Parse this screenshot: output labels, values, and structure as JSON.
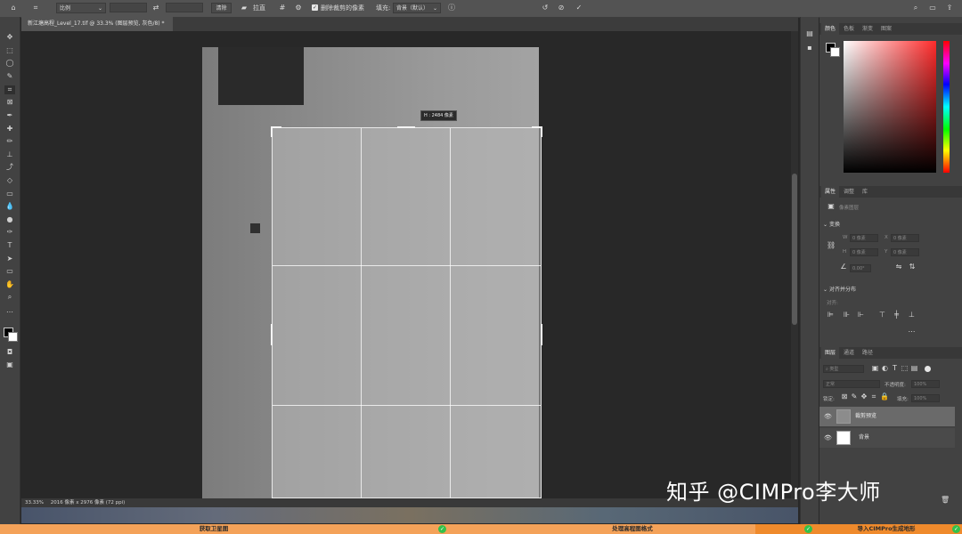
{
  "options_bar": {
    "ratio_select": "比例",
    "clear_button": "清除",
    "straighten_label": "拉直",
    "delete_cropped_label": "删除裁剪的像素",
    "fill_label": "填充:",
    "fill_select": "背景（默认）"
  },
  "document": {
    "tab_title": "新江塘高程_Level_17.tif @ 33.3% (图层预览, 灰色/8) *"
  },
  "canvas": {
    "tooltip": "H : 2484 像素"
  },
  "status_bar": {
    "zoom": "33.33%",
    "doc_info": "2016 像素 x 2976 像素 (72 ppi)"
  },
  "color_panel": {
    "tabs": [
      "颜色",
      "色板",
      "渐变",
      "图案"
    ],
    "active_tab": 0
  },
  "properties_panel": {
    "tabs": [
      "属性",
      "调整",
      "库"
    ],
    "active_tab": 0,
    "pixel_layer_label": "像素图层",
    "transform_label": "变换",
    "w_label": "W",
    "w_value": "0 像素",
    "x_label": "X",
    "x_value": "0 像素",
    "h_label": "H",
    "h_value": "0 像素",
    "y_label": "Y",
    "y_value": "0 像素",
    "angle_value": "0.00°",
    "align_label": "对齐并分布",
    "align_sub": "对齐:"
  },
  "layers_panel": {
    "tabs": [
      "图层",
      "通道",
      "路径"
    ],
    "active_tab": 0,
    "kind_select": "类型",
    "blend_mode": "正常",
    "opacity_label": "不透明度:",
    "opacity_value": "100%",
    "lock_label": "锁定:",
    "fill_label": "填充:",
    "fill_value": "100%",
    "layers": [
      {
        "name": "裁剪预览",
        "selected": true
      },
      {
        "name": "背景",
        "selected": false
      }
    ]
  },
  "bottom_bar": {
    "step1": "获取卫星图",
    "step2": "处理高程图格式",
    "step3": "导入CIMPro生成地形"
  },
  "watermark": "知乎 @CIMPro李大师",
  "colors": {
    "accent_orange": "#f4a259",
    "check_green": "#33c14a",
    "panel_bg": "#424242"
  }
}
